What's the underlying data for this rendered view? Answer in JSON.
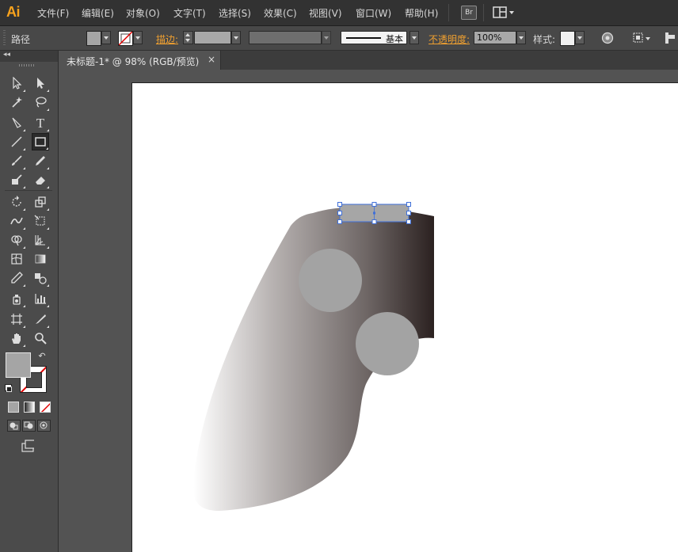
{
  "app": {
    "logo": "Ai"
  },
  "menu": {
    "items": [
      "文件(F)",
      "编辑(E)",
      "对象(O)",
      "文字(T)",
      "选择(S)",
      "效果(C)",
      "视图(V)",
      "窗口(W)",
      "帮助(H)"
    ],
    "bridge_label": "Br"
  },
  "control_bar": {
    "selection_label": "路径",
    "stroke_label": "描边:",
    "stroke_style_label": "基本",
    "opacity_label": "不透明度:",
    "opacity_value": "100%",
    "style_label": "样式:"
  },
  "toolbar": {
    "collapse_glyph": "◂◂",
    "fill_color": "#a5a5a5",
    "stroke_color": "none"
  },
  "document": {
    "tab_title": "未标题-1* @ 98% (RGB/预览)",
    "close_glyph": "×"
  },
  "artwork": {
    "handle_gradient": [
      "#ffffff",
      "#b7b2b1",
      "#6e6665",
      "#2b2120"
    ],
    "circle_color": "#a3a3a3",
    "selected_rect_color": "#a6a6a6",
    "selection_color": "#3f6fd8"
  },
  "colors": {
    "accent": "#f7a21d",
    "orange_label": "#f0a030",
    "ui_dark": "#323232",
    "ui_mid": "#484848",
    "canvas_bg": "#535353"
  }
}
